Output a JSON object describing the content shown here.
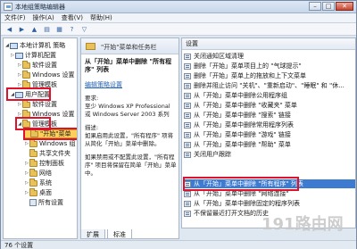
{
  "window": {
    "title": "本地组策略编辑器"
  },
  "menubar": [
    "文件(F)",
    "操作(A)",
    "查看(V)",
    "帮助(H)"
  ],
  "toolbar_icons": [
    "back-arrow-icon",
    "forward-arrow-icon",
    "folder-up-icon",
    "show-hide-tree-icon",
    "export-list-icon",
    "help-icon",
    "filter-icon"
  ],
  "tree": {
    "items": [
      {
        "label": "本地计算机 策略",
        "expander": "◢"
      },
      {
        "label": "计算机配置",
        "expander": "▷"
      },
      {
        "label": "软件设置",
        "expander": "▷"
      },
      {
        "label": "Windows 设置",
        "expander": "▷"
      },
      {
        "label": "管理模板",
        "expander": "▷"
      },
      {
        "label": "用户配置",
        "expander": "◢"
      },
      {
        "label": "软件设置",
        "expander": "▷"
      },
      {
        "label": "Windows 设置",
        "expander": "▷"
      },
      {
        "label": "管理模板",
        "expander": "◢"
      },
      {
        "label": "\"开始\"菜单",
        "expander": ""
      },
      {
        "label": "Windows 组",
        "expander": "▷"
      },
      {
        "label": "共享文件夹",
        "expander": ""
      },
      {
        "label": "控制面板",
        "expander": "▷"
      },
      {
        "label": "网络",
        "expander": "▷"
      },
      {
        "label": "系统",
        "expander": "▷"
      },
      {
        "label": "桌面",
        "expander": "▷"
      },
      {
        "label": "所有设置",
        "expander": ""
      }
    ]
  },
  "middle": {
    "header": "\"开始\"菜单和任务栏",
    "policy_title": "从「开始」菜单中删除 \"所有程序\" 列表",
    "edit_link": "编辑策略设置",
    "req_label": "要求:",
    "req_text": "至少 Windows XP Professional 或 Windows Server 2003 系列",
    "desc_label": "描述:",
    "desc_text": "如果启用此设置，\"所有程序\" 项将从简化「开始」菜单中删除。",
    "desc_text2": "如果禁用或不配置此设置，\"所有程序\" 项目将保留在简单「开始」菜单中。"
  },
  "right": {
    "column_header": "设置",
    "settings": [
      "关闭通知区域清理",
      "删除「开始」菜单项目上的 \"气球提示\"",
      "删除「开始」菜单上的拖放和上下文菜单",
      "删除并阻止访问 \"关机\"、\"重新启动\"、\"睡眠\" 和 \"休...",
      "从「开始」菜单中删除公用程序组",
      "从「开始」菜单中删除 \"收藏夹\" 菜单",
      "从「开始」菜单中删除 \"搜索\" 链接",
      "从「开始」菜单中删除常用程序列表",
      "从「开始」菜单中删除 \"游戏\" 链接",
      "从「开始」菜单中删除 \"帮助\" 菜单",
      "关闭用户跟踪",
      "从「开始」菜单中删除 \"所有程序\" 列表",
      "从「开始」菜单中删除 \"网络连接\"",
      "从「开始」菜单中删除固定的程序列表",
      "不保留最近打开文档的历史"
    ]
  },
  "tabs": [
    "扩展",
    "标准"
  ],
  "status": "76 个设置",
  "watermark": "191路由网",
  "colors": {
    "highlight_red": "#e0112b",
    "selection_blue": "#3d7bd1"
  }
}
